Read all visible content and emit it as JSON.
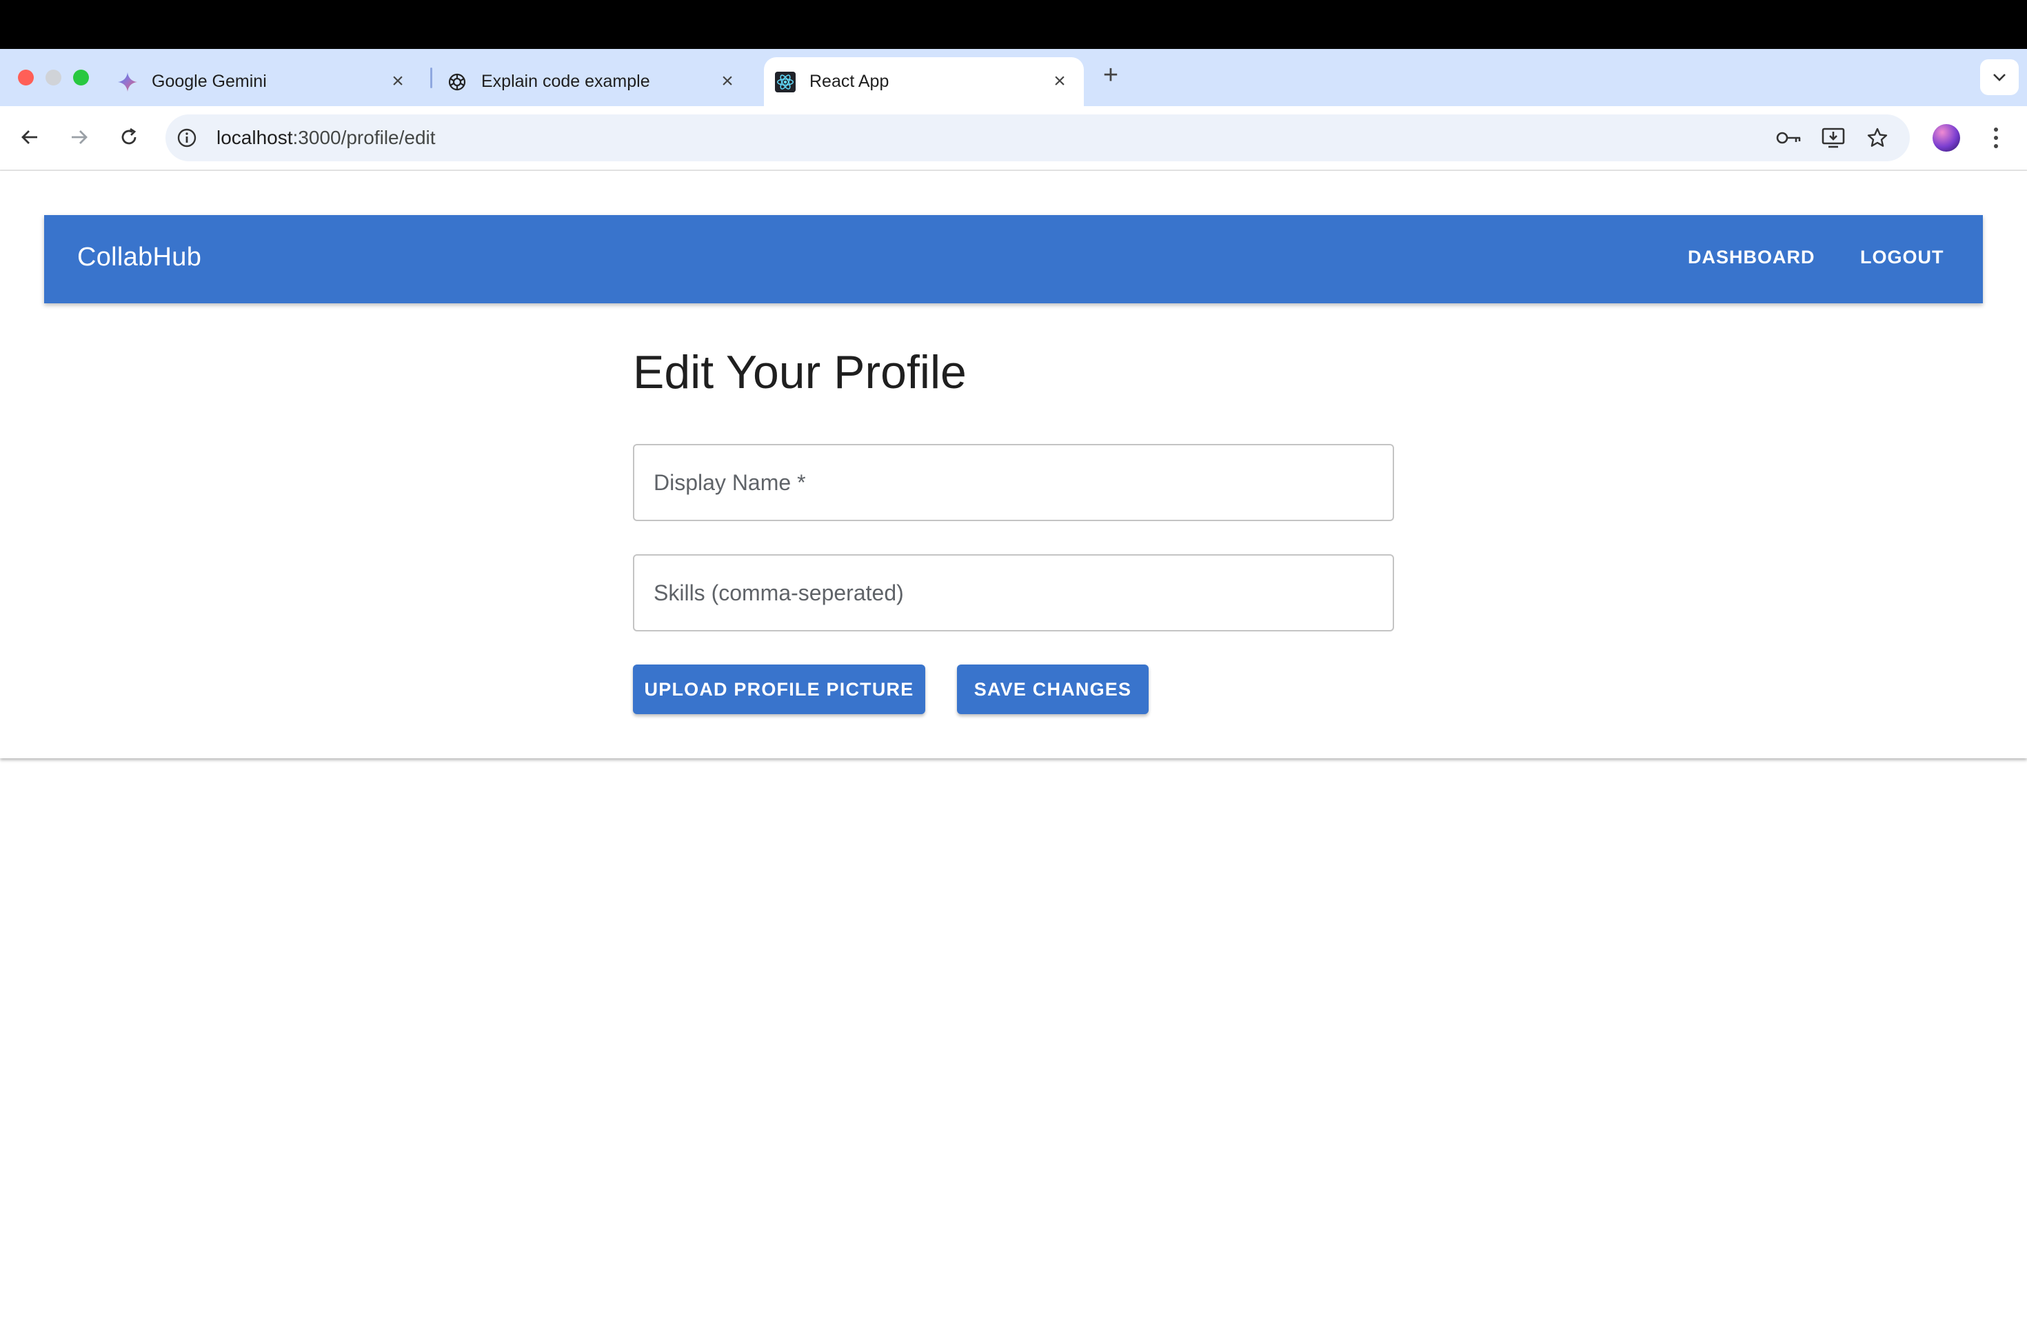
{
  "browser": {
    "tabs": [
      {
        "title": "Google Gemini",
        "favicon": "gemini-icon"
      },
      {
        "title": "Explain code example",
        "favicon": "chatgpt-icon"
      },
      {
        "title": "React App",
        "favicon": "react-icon",
        "active": true
      }
    ],
    "url_host": "localhost",
    "url_path": ":3000/profile/edit"
  },
  "app": {
    "brand": "CollabHub",
    "nav": {
      "dashboard": "DASHBOARD",
      "logout": "LOGOUT"
    },
    "accent": "#3974cc"
  },
  "form": {
    "title": "Edit Your Profile",
    "display_name_label": "Display Name *",
    "display_name_value": "",
    "skills_label": "Skills (comma-seperated)",
    "skills_value": "",
    "upload_label": "UPLOAD PROFILE PICTURE",
    "save_label": "SAVE CHANGES"
  }
}
